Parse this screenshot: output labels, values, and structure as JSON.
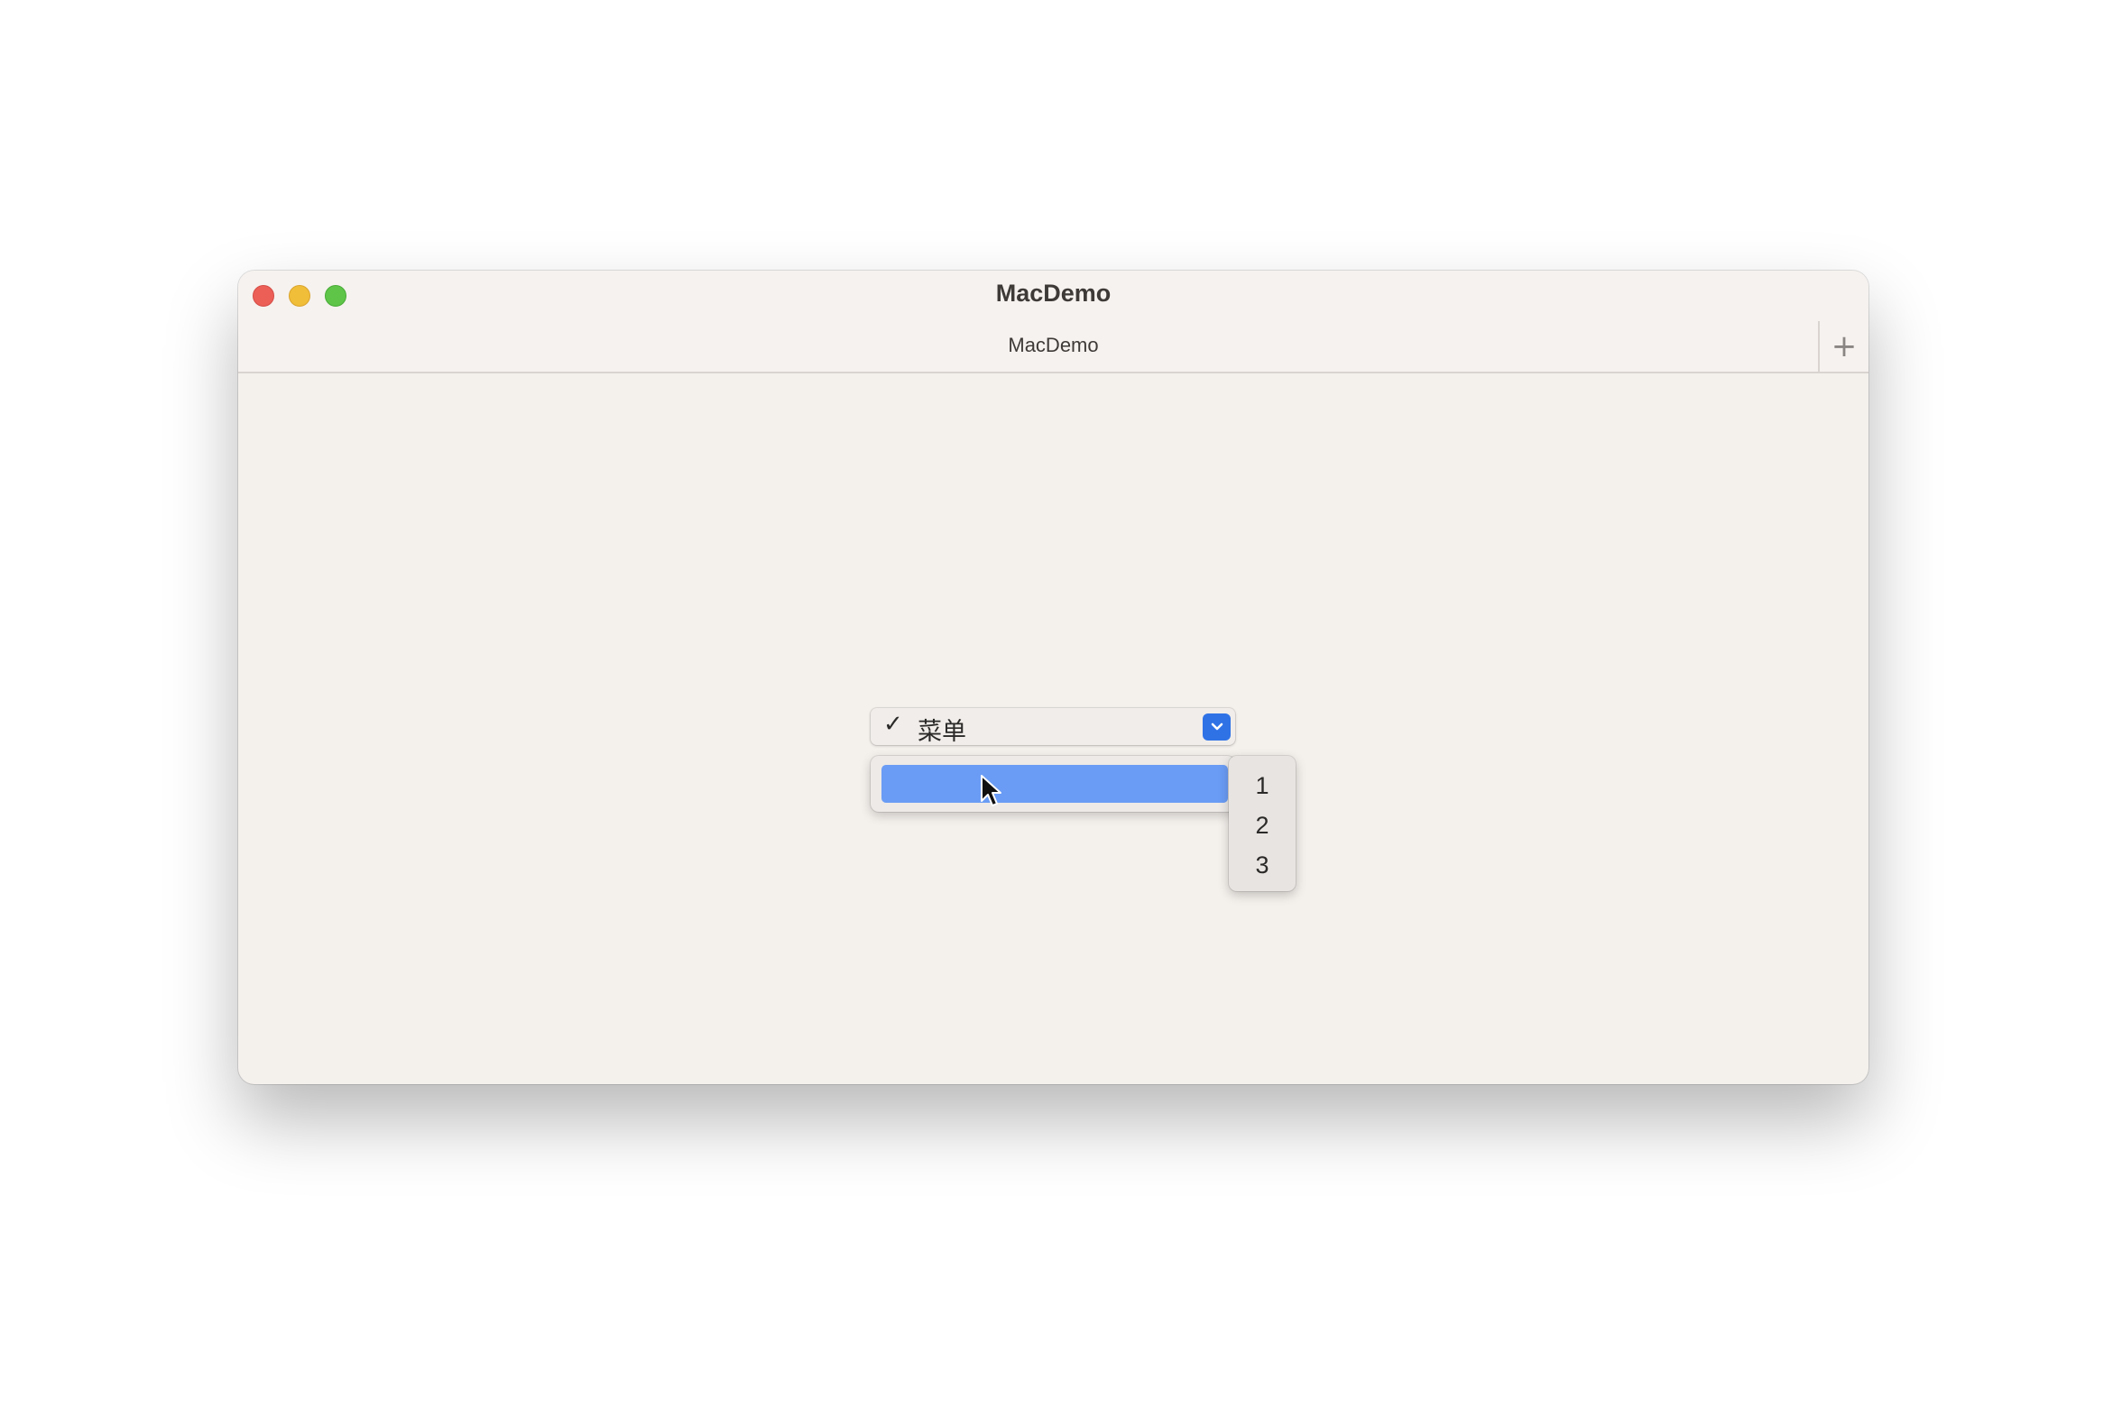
{
  "window": {
    "title": "MacDemo",
    "tab_title": "MacDemo",
    "new_tab_symbol": "+"
  },
  "popup": {
    "check_symbol": "✓",
    "selected_label": "菜单"
  },
  "submenu": {
    "items": [
      "1",
      "2",
      "3"
    ]
  },
  "colors": {
    "accent": "#2f72e6",
    "menu_highlight": "#6a9cf5",
    "close": "#ec5f57",
    "minimize": "#f1be3a",
    "zoom": "#5ec549"
  },
  "icons": {
    "dropdown": "chevron-down-icon",
    "cursor": "mouse-pointer-icon"
  }
}
